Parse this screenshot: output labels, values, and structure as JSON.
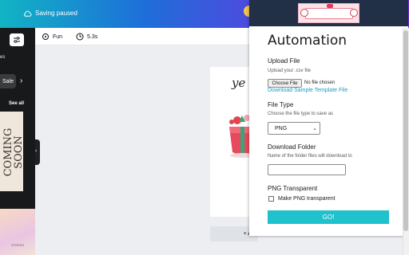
{
  "topbar": {
    "status": "Saving paused"
  },
  "sidebar": {
    "fragment_label": "es",
    "sale_chip": "Sale",
    "see_all": "See all",
    "thumb_text": "COMING SOON",
    "thumb_small": "STRESS"
  },
  "toolbar": {
    "font_label": "Fun",
    "duration_label": "5.3s"
  },
  "canvas": {
    "text": "ye"
  },
  "add_page": "+ Ad",
  "popup": {
    "title": "Automation",
    "upload_title": "Upload File",
    "upload_desc": "Upload your .csv file",
    "choose_file": "Choose File",
    "no_file": "No file chosen",
    "download_sample": "Download Sample Template File",
    "filetype_title": "File Type",
    "filetype_desc": "Choose the file type to save as",
    "filetype_value": "PNG",
    "folder_title": "Download Folder",
    "folder_desc": "Name of the folder files will download to",
    "folder_value": "",
    "png_title": "PNG Transparent",
    "png_checkbox_label": "Make PNG transparent",
    "go": "GO!"
  },
  "colors": {
    "go_button": "#1ec1cc",
    "link": "#1a9bc8",
    "header": "#223047"
  }
}
